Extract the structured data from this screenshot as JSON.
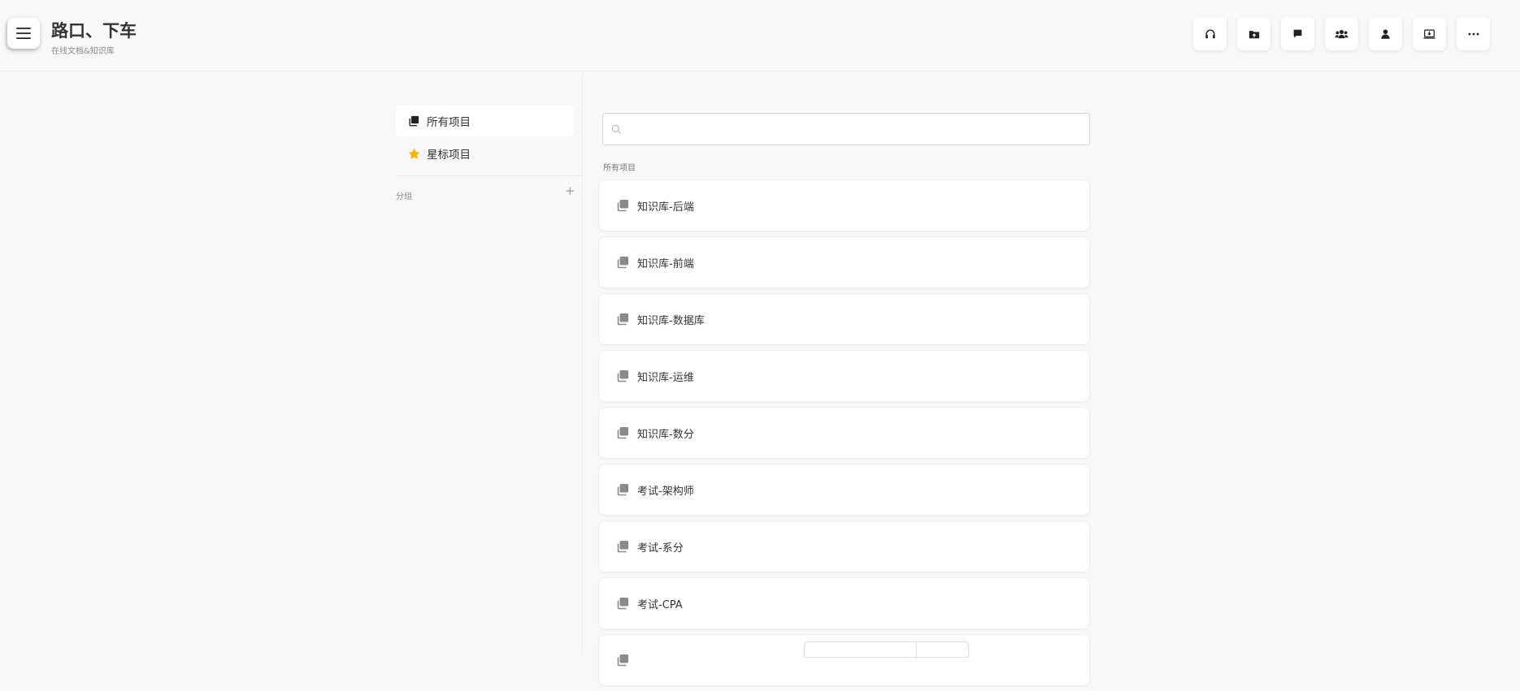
{
  "header": {
    "title": "路口、下车",
    "subtitle": "在线文档&知识库",
    "menu_icon": "hamburger-menu-icon",
    "toolbar": [
      {
        "name": "headphones-icon"
      },
      {
        "name": "folder-upload-icon"
      },
      {
        "name": "comment-icon"
      },
      {
        "name": "users-icon"
      },
      {
        "name": "user-icon"
      },
      {
        "name": "import-icon"
      },
      {
        "name": "more-icon"
      }
    ]
  },
  "sidebar": {
    "items": [
      {
        "label": "所有项目",
        "icon": "stack-icon",
        "active": true
      },
      {
        "label": "星标项目",
        "icon": "star-icon",
        "active": false
      }
    ],
    "group_label": "分组",
    "group_add": "+"
  },
  "main": {
    "search": {
      "placeholder": "",
      "value": ""
    },
    "section_label": "所有项目",
    "projects": [
      {
        "title": "知识库-后端"
      },
      {
        "title": "知识库-前端"
      },
      {
        "title": "知识库-数据库"
      },
      {
        "title": "知识库-运维"
      },
      {
        "title": "知识库-数分"
      },
      {
        "title": "考试-架构师"
      },
      {
        "title": "考试-系分"
      },
      {
        "title": "考试-CPA"
      },
      {
        "title": ""
      }
    ]
  },
  "colors": {
    "background": "#f8f8f8",
    "card": "#ffffff",
    "star": "#f5b400",
    "icon": "#8a8a8a"
  }
}
